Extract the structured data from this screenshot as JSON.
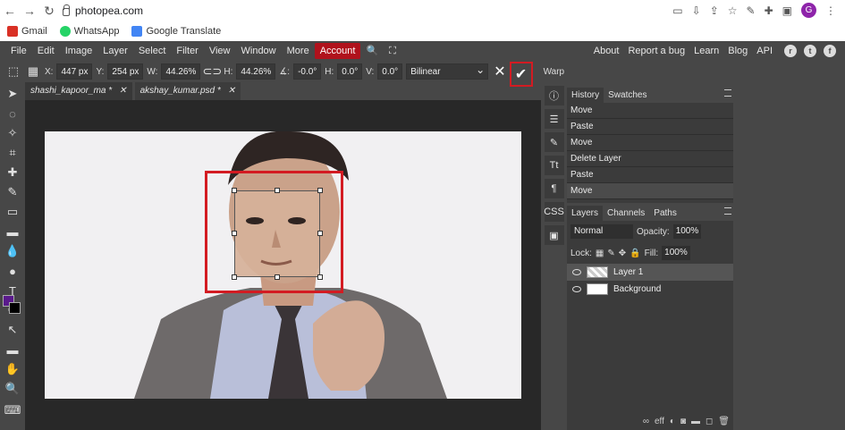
{
  "browser": {
    "url": "photopea.com",
    "avatar_letter": "G",
    "bookmarks": [
      {
        "label": "Gmail",
        "color": "#d93025"
      },
      {
        "label": "WhatsApp",
        "color": "#25d366"
      },
      {
        "label": "Google Translate",
        "color": "#4285f4"
      }
    ]
  },
  "menu": {
    "items": [
      "File",
      "Edit",
      "Image",
      "Layer",
      "Select",
      "Filter",
      "View",
      "Window",
      "More"
    ],
    "account": "Account",
    "right": [
      "About",
      "Report a bug",
      "Learn",
      "Blog",
      "API"
    ]
  },
  "options": {
    "x_label": "X:",
    "x_value": "447 px",
    "y_label": "Y:",
    "y_value": "254 px",
    "w_label": "W:",
    "w_value": "44.26%",
    "h_label": "H:",
    "h_value": "44.26%",
    "angle_value": "-0.0°",
    "hskew_label": "H:",
    "hskew_value": "0.0°",
    "vskew_label": "V:",
    "vskew_value": "0.0°",
    "interpolation": "Bilinear",
    "warp": "Warp"
  },
  "tabs": [
    {
      "label": "shashi_kapoor_ma *"
    },
    {
      "label": "akshay_kumar.psd *"
    }
  ],
  "history": {
    "tabs": [
      "History",
      "Swatches"
    ],
    "rows": [
      "Move",
      "Paste",
      "Move",
      "Delete Layer",
      "Paste",
      "Move"
    ]
  },
  "layers": {
    "tabs": [
      "Layers",
      "Channels",
      "Paths"
    ],
    "blend_mode": "Normal",
    "opacity_label": "Opacity:",
    "opacity_value": "100%",
    "lock_label": "Lock:",
    "fill_label": "Fill:",
    "fill_value": "100%",
    "items": [
      "Layer 1",
      "Background"
    ]
  },
  "colors": {
    "accent_red": "#d31b22",
    "foreground": "#5a1a8c",
    "background": "#000000"
  }
}
